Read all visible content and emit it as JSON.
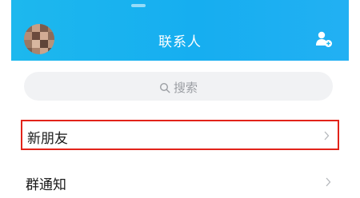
{
  "header": {
    "title": "联系人"
  },
  "search": {
    "placeholder": "搜索"
  },
  "list": {
    "items": [
      {
        "label": "新朋友"
      },
      {
        "label": "群通知"
      }
    ]
  },
  "colors": {
    "header_bg": "#1db8ee",
    "highlight_border": "#e2231a",
    "search_bg": "#f1f2f4"
  },
  "icons": {
    "avatar": "avatar",
    "add_contact": "add-contact-icon",
    "search": "search-icon",
    "chevron": "chevron-right-icon"
  }
}
